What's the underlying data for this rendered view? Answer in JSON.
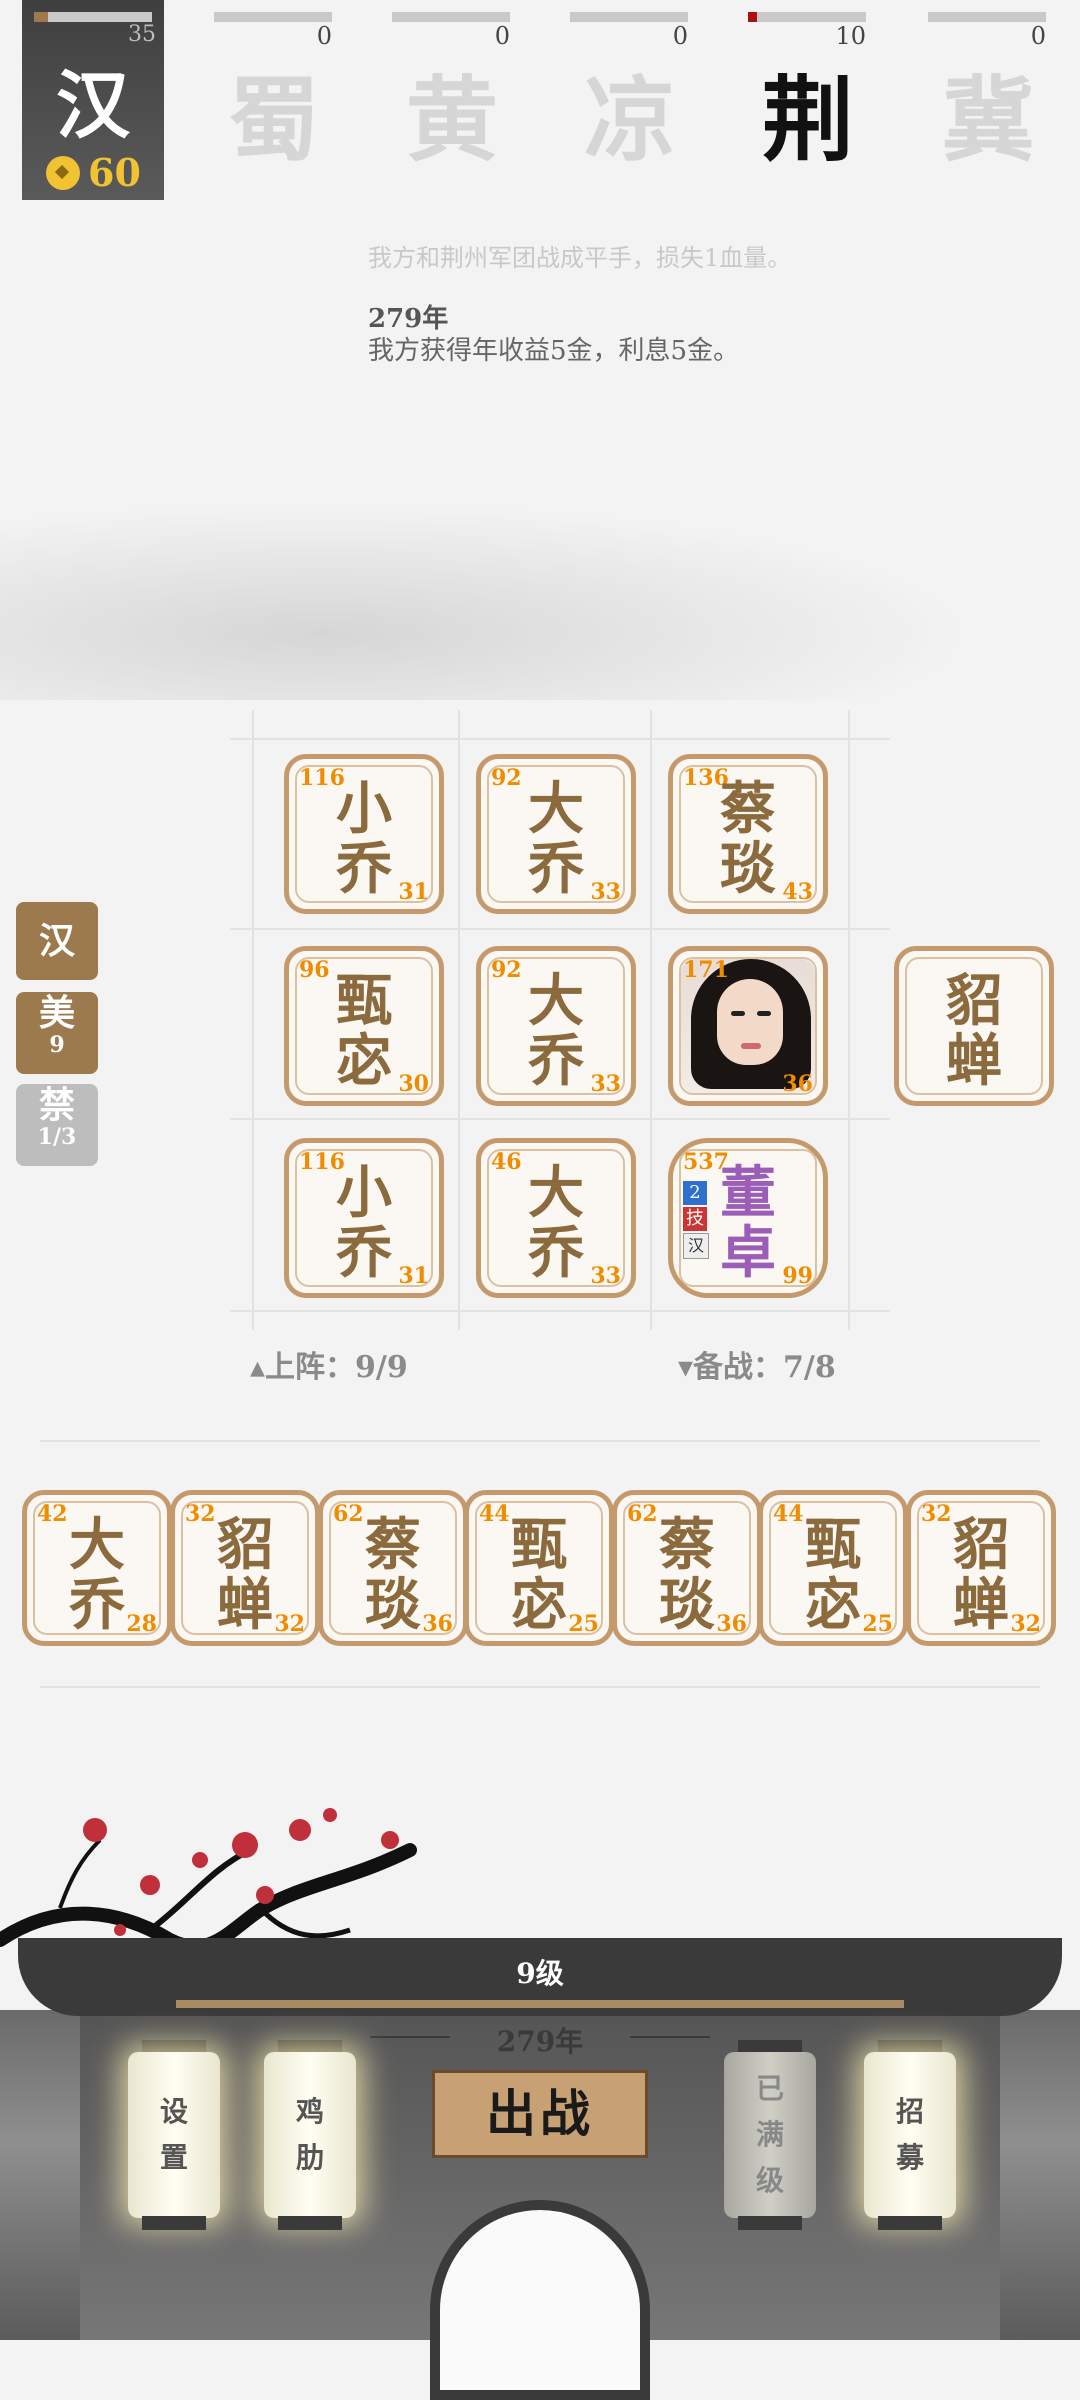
{
  "player": {
    "name": "汉",
    "score": "35",
    "gold": "60",
    "progress": 0.12
  },
  "factions": [
    {
      "name": "蜀",
      "score": "0",
      "progress": 0,
      "active": false
    },
    {
      "name": "黄",
      "score": "0",
      "progress": 0,
      "active": false
    },
    {
      "name": "凉",
      "score": "0",
      "progress": 0,
      "active": false
    },
    {
      "name": "荆",
      "score": "10",
      "progress": 0.08,
      "active": true
    },
    {
      "name": "冀",
      "score": "0",
      "progress": 0,
      "active": false
    }
  ],
  "log": {
    "faded_line": "我方和荆州军团战成平手，损失1血量。",
    "year": "279年",
    "text": "我方获得年收益5金，利息5金。"
  },
  "side_tags": [
    {
      "label": "汉",
      "sub": ""
    },
    {
      "label": "美",
      "sub": "9"
    },
    {
      "label": "禁",
      "sub": "1/3"
    }
  ],
  "board": [
    {
      "name1": "小",
      "name2": "乔",
      "power": "116",
      "level": "31"
    },
    {
      "name1": "大",
      "name2": "乔",
      "power": "92",
      "level": "33"
    },
    {
      "name1": "蔡",
      "name2": "琰",
      "power": "136",
      "level": "43"
    },
    {
      "name1": "甄",
      "name2": "宓",
      "power": "96",
      "level": "30"
    },
    {
      "name1": "大",
      "name2": "乔",
      "power": "92",
      "level": "33"
    },
    {
      "name1": "",
      "name2": "",
      "power": "171",
      "level": "36"
    },
    {
      "name1": "小",
      "name2": "乔",
      "power": "116",
      "level": "31"
    },
    {
      "name1": "大",
      "name2": "乔",
      "power": "46",
      "level": "33"
    },
    {
      "name1": "董",
      "name2": "卓",
      "power": "537",
      "level": "99",
      "badge_num": "2",
      "badge_skill": "技",
      "badge_faction": "汉"
    }
  ],
  "preview_card": {
    "name1": "貂",
    "name2": "蝉"
  },
  "counts": {
    "deployed": "▴上阵：9/9",
    "reserve": "▾备战：7/8"
  },
  "bench": [
    {
      "name1": "大",
      "name2": "乔",
      "power": "42",
      "level": "28"
    },
    {
      "name1": "貂",
      "name2": "蝉",
      "power": "32",
      "level": "32"
    },
    {
      "name1": "蔡",
      "name2": "琰",
      "power": "62",
      "level": "36"
    },
    {
      "name1": "甄",
      "name2": "宓",
      "power": "44",
      "level": "25"
    },
    {
      "name1": "蔡",
      "name2": "琰",
      "power": "62",
      "level": "36"
    },
    {
      "name1": "甄",
      "name2": "宓",
      "power": "44",
      "level": "25"
    },
    {
      "name1": "貂",
      "name2": "蝉",
      "power": "32",
      "level": "32"
    }
  ],
  "bottom": {
    "level": "9级",
    "year": "279年",
    "battle": "出战",
    "lanterns": [
      {
        "line1": "设",
        "line2": "置",
        "line3": ""
      },
      {
        "line1": "鸡",
        "line2": "肋",
        "line3": ""
      },
      {
        "line1": "已",
        "line2": "满",
        "line3": "级"
      },
      {
        "line1": "招",
        "line2": "募",
        "line3": ""
      }
    ]
  },
  "colors": {
    "card_border": "#c49a6c",
    "card_text": "#8b6a3e",
    "stat_orange": "#f08c00",
    "boss_purple": "#9b5db8",
    "gold": "#f1c232"
  }
}
